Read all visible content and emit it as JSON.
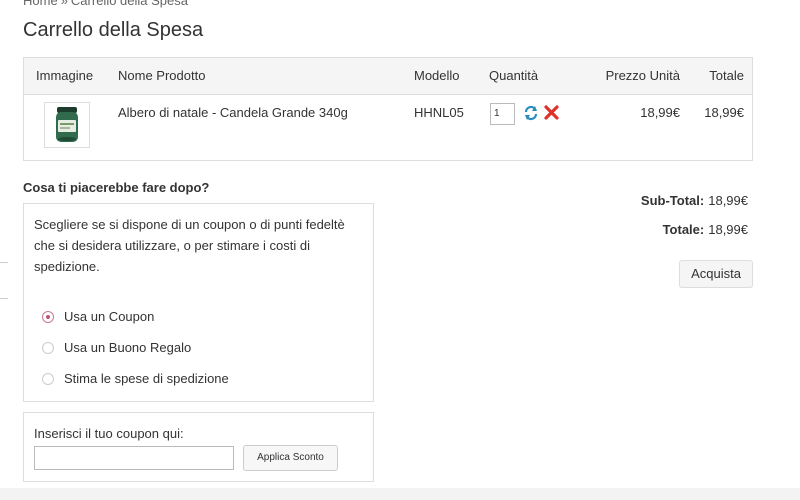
{
  "breadcrumb": {
    "items": [
      "Home",
      "Carrello della Spesa"
    ],
    "separator": "»"
  },
  "page_title": "Carrello della Spesa",
  "cart_table": {
    "headers": {
      "image": "Immagine",
      "name": "Nome Prodotto",
      "model": "Modello",
      "quantity": "Quantità",
      "unit_price": "Prezzo Unità",
      "total": "Totale"
    },
    "rows": [
      {
        "name": "Albero di natale - Candela Grande 340g",
        "model": "HHNL05",
        "quantity": "1",
        "unit_price": "18,99€",
        "total": "18,99€"
      }
    ]
  },
  "next_steps": {
    "title": "Cosa ti piacerebbe fare dopo?",
    "description": "Scegliere se si dispone di un coupon o di punti fedeltè che si desidera utilizzare, o per stimare i costi di spedizione.",
    "options": [
      {
        "label": "Usa un Coupon",
        "selected": true
      },
      {
        "label": "Usa un Buono Regalo",
        "selected": false
      },
      {
        "label": "Stima le spese di spedizione",
        "selected": false
      }
    ]
  },
  "coupon": {
    "label": "Inserisci il tuo coupon qui:",
    "value": "",
    "apply_label": "Applica Sconto"
  },
  "totals": {
    "subtotal_label": "Sub-Total:",
    "subtotal_value": "18,99€",
    "total_label": "Totale:",
    "total_value": "18,99€"
  },
  "checkout_label": "Acquista",
  "colors": {
    "accent_radio": "#c0527e",
    "update_icon": "#2a8bbf",
    "remove_icon": "#e0302a"
  },
  "icons": {
    "update": "refresh-icon",
    "remove": "remove-icon",
    "product": "candle-jar-image"
  }
}
